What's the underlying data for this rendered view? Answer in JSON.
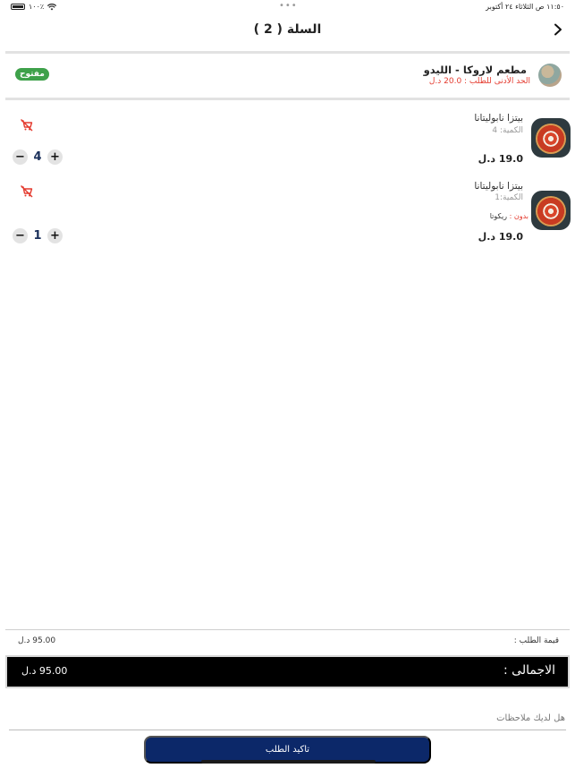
{
  "status_bar": {
    "time_date": "١١:٥٠ ص   الثلاثاء ٢٤ أكتوبر",
    "battery": "١٠٠٪",
    "dots": "•••"
  },
  "header": {
    "title": "السلة ( 2 )",
    "back_icon": "chevron-right-icon"
  },
  "restaurant": {
    "name": "مطعم لاروكا - الليدو",
    "min_order": "الحد الأدنى للطلب : 20.0 د.ل",
    "status": "مفتوح",
    "status_color": "#3ea14a"
  },
  "cart_items": [
    {
      "name": "بيتزا نابوليتانا",
      "quantity_label": "الكمية: 4",
      "note_prefix": "",
      "note_value": "",
      "price": "19.0 د.ل",
      "quantity": "4"
    },
    {
      "name": "بيتزا نابوليتانا",
      "quantity_label": "الكمية:1",
      "note_prefix": "بدون :",
      "note_value": "ريكوتا",
      "price": "19.0 د.ل",
      "quantity": "1"
    }
  ],
  "summary": {
    "subtotal_label": "قيمة الطلب :",
    "subtotal_value": "95.00 د.ل",
    "total_label": "الاجمالى :",
    "total_value": "95.00 د.ل"
  },
  "notes": {
    "placeholder": "هل لديك ملاحظات"
  },
  "actions": {
    "confirm_label": "تاكيد الطلب"
  },
  "colors": {
    "accent_red": "#e43a2e",
    "confirm_bg": "#0c2869",
    "total_bg": "#000000"
  }
}
